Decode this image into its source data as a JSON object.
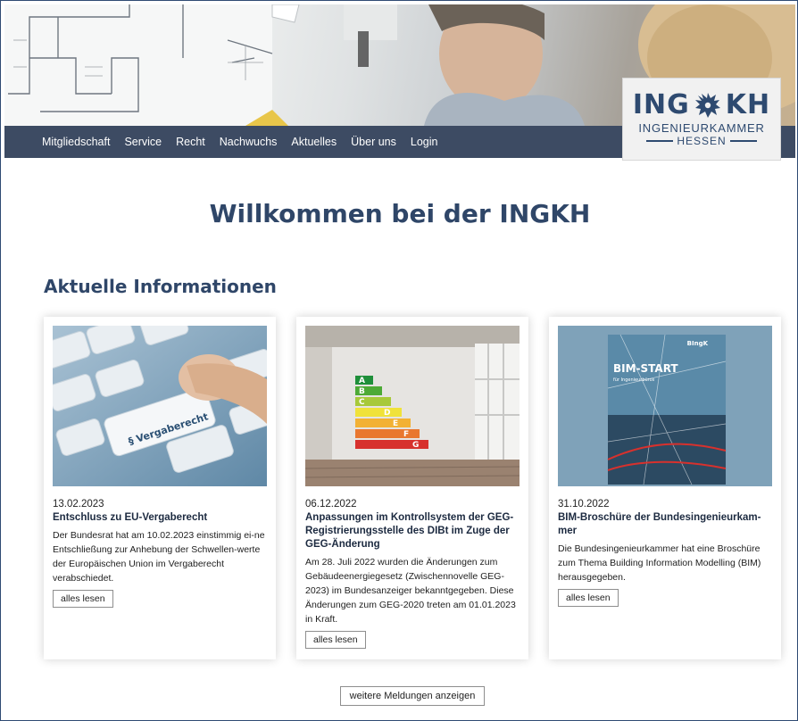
{
  "nav": {
    "items": [
      "Mitgliedschaft",
      "Service",
      "Recht",
      "Nachwuchs",
      "Aktuelles",
      "Über uns",
      "Login"
    ]
  },
  "logo": {
    "left": "ING",
    "right": "KH",
    "line1": "INGENIEURKAMMER",
    "line2": "HESSEN"
  },
  "welcome": "Willkommen bei der INGKH",
  "section_title": "Aktuelle Informationen",
  "cards": [
    {
      "date": "13.02.2023",
      "title": "Entschluss zu EU-Vergaberecht",
      "text": "Der Bundesrat hat am 10.02.2023 einstimmig ei-ne Entschließung zur Anhebung der Schwellen-werte der Europäischen Union im Vergaberecht verabschiedet.",
      "button": "alles lesen",
      "image_keyword": "§ Vergaberecht"
    },
    {
      "date": "06.12.2022",
      "title": "Anpassungen im Kontrollsystem der GEG-Registrierungsstelle des DIBt im Zuge der GEG-Änderung",
      "text": "Am 28. Juli 2022 wurden die Änderungen zum Gebäudeenergiegesetz (Zwischennovelle GEG-2023) im Bundesanzeiger bekanntgegeben. Diese Änderungen zum GEG-2020 treten am 01.01.2023 in Kraft.",
      "button": "alles lesen",
      "image_labels": [
        "A",
        "B",
        "C",
        "D",
        "E",
        "F",
        "G"
      ]
    },
    {
      "date": "31.10.2022",
      "title": "BIM-Broschüre der Bundesingenieurkam-mer",
      "text": "Die Bundesingenieurkammer hat eine Broschüre zum Thema Building Information Modelling (BIM) herausgegeben.",
      "button": "alles lesen",
      "image_title": "BIM-START",
      "image_subtitle": "für Ingenieurbüros",
      "image_brand": "BIngK"
    }
  ],
  "more_button": "weitere Meldungen anzeigen",
  "colors": {
    "nav_bg": "#3d4b63",
    "heading": "#2f4668",
    "logo": "#2e4a70"
  }
}
